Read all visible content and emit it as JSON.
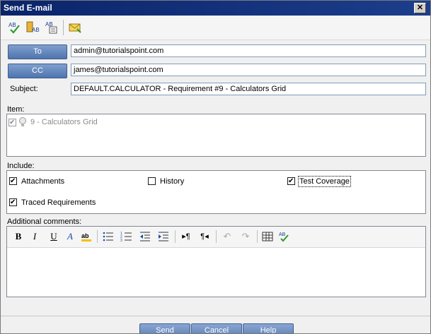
{
  "window": {
    "title": "Send E-mail"
  },
  "toolbar": {
    "spell_check_icon": "spell-check-icon",
    "thesaurus_icon": "thesaurus-icon",
    "spelling_options_icon": "spelling-options-icon",
    "send_icon": "envelope-icon"
  },
  "form": {
    "to_label": "To",
    "to_value": "admin@tutorialspoint.com",
    "cc_label": "CC",
    "cc_value": "james@tutorialspoint.com",
    "subject_label": "Subject:",
    "subject_value": "DEFAULT.CALCULATOR  - Requirement #9 - Calculators Grid"
  },
  "item": {
    "label": "Item:",
    "entry": "9 - Calculators Grid",
    "checked": true
  },
  "include": {
    "label": "Include:",
    "options": [
      {
        "label": "Attachments",
        "checked": true
      },
      {
        "label": "History",
        "checked": false
      },
      {
        "label": "Test Coverage",
        "checked": true
      },
      {
        "label": "Traced Requirements",
        "checked": true
      }
    ]
  },
  "comments": {
    "label": "Additional comments:",
    "value": ""
  },
  "buttons": {
    "send": "Send",
    "cancel": "Cancel",
    "help": "Help"
  },
  "colors": {
    "title_bar": "#0a246a",
    "label_button": "#5a7cb4"
  }
}
